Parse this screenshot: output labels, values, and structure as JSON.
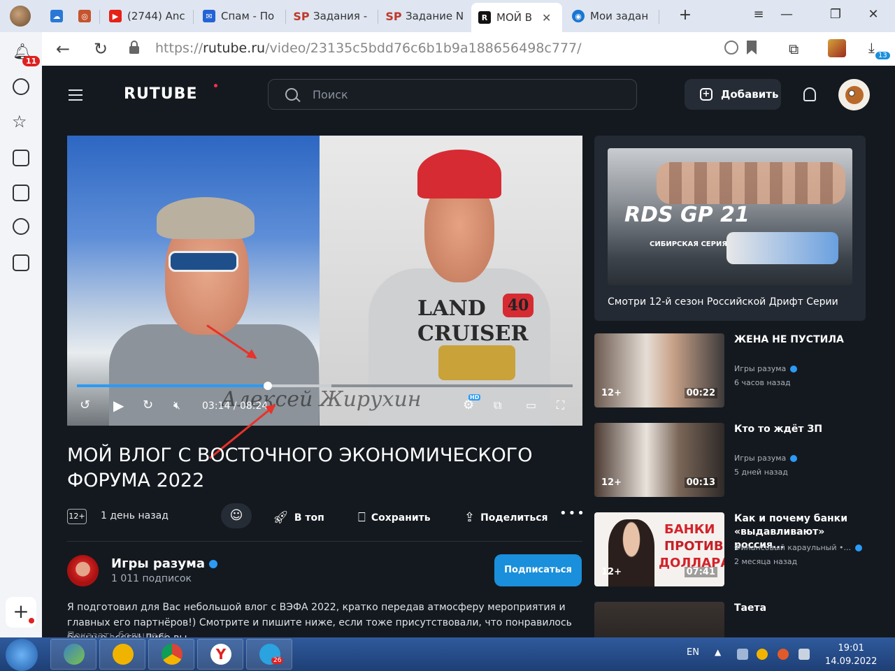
{
  "browser": {
    "tabs": [
      {
        "label": "",
        "icon": "cloud-icon",
        "color": "#2a78d6"
      },
      {
        "label": "",
        "icon": "extension-icon",
        "color": "#c7532e"
      },
      {
        "label": "(2744) Anc",
        "icon": "youtube-icon",
        "color": "#e62117"
      },
      {
        "label": "Спам - По",
        "icon": "mail-icon",
        "color": "#2463d6"
      },
      {
        "label": "Задания -",
        "icon": "sp-icon",
        "color": "#c0392b"
      },
      {
        "label": "Задание N",
        "icon": "sp-icon",
        "color": "#c0392b"
      },
      {
        "label": "МОЙ В",
        "icon": "rutube-icon",
        "color": "#111111"
      },
      {
        "label": "Мои задан",
        "icon": "target-icon",
        "color": "#1976d2"
      }
    ],
    "url_prefix": "https://",
    "url_host": "rutube.ru",
    "url_path": "/video/23135c5bdd76c6b1b9a188656498c777/",
    "notif_badge": "11",
    "downloads_badge": "13"
  },
  "site": {
    "logo": "RUTUBE",
    "search_placeholder": "Поиск",
    "add_label": "Добавить"
  },
  "player": {
    "current_time": "03:14",
    "duration": "08:24",
    "progress": 0.385,
    "buffered": 0.514,
    "hd_badge": "HD",
    "shirt_line1": "LAND",
    "shirt_line2": "CRUISER",
    "shirt_number": "40",
    "watermark": "Алексей Жирухин"
  },
  "video": {
    "title": "МОЙ ВЛОГ С ВОСТОЧНОГО ЭКОНОМИЧЕСКОГО ФОРУМА 2022",
    "age": "12+",
    "published": "1 день назад",
    "top_label": "В топ",
    "save_label": "Сохранить",
    "share_label": "Поделиться",
    "more_label": "•••"
  },
  "channel": {
    "name": "Игры разума",
    "subscribers": "1 011 подписок",
    "subscribe_label": "Подписаться"
  },
  "description": {
    "text": "Я подготовил для Вас небольшой влог с ВЭФА 2022, кратко передав атмосферу мероприятия и главных его партнёров!) Смотрите и пишите ниже, если тоже присутствовали, что понравилось больше всего! Либо вы...",
    "more": "Показать больше ∨"
  },
  "promo": {
    "headline": "RDS GP 21",
    "subline": "СИБИРСКАЯ СЕРИЯ",
    "caption": "Смотри 12-й сезон Российской Дрифт Серии"
  },
  "recommendations": [
    {
      "title": "ЖЕНА НЕ ПУСТИЛА",
      "channel": "Игры разума",
      "when": "6 часов назад",
      "age": "12+",
      "duration": "00:22"
    },
    {
      "title": "Кто то ждёт ЗП",
      "channel": "Игры разума",
      "when": "5 дней назад",
      "age": "12+",
      "duration": "00:13"
    },
    {
      "title": "Как и почему банки «выдавливают» россия...",
      "channel": "Финансовый караульный •...",
      "when": "2 месяца назад",
      "age": "12+",
      "duration": "07:41",
      "thumb_line1": "БАНКИ",
      "thumb_line2": "ПРОТИВ",
      "thumb_line3": "ДОЛЛАРА"
    },
    {
      "title": "Таета",
      "channel": "",
      "when": "",
      "age": "",
      "duration": ""
    }
  ],
  "taskbar": {
    "lang": "EN",
    "time": "19:01",
    "date": "14.09.2022",
    "telegram_badge": "26"
  },
  "colors": {
    "page_bg": "#14191f",
    "accent_blue": "#2b9bf5",
    "subscribe_blue": "#1a8fdb",
    "arrow_red": "#e8322a"
  }
}
